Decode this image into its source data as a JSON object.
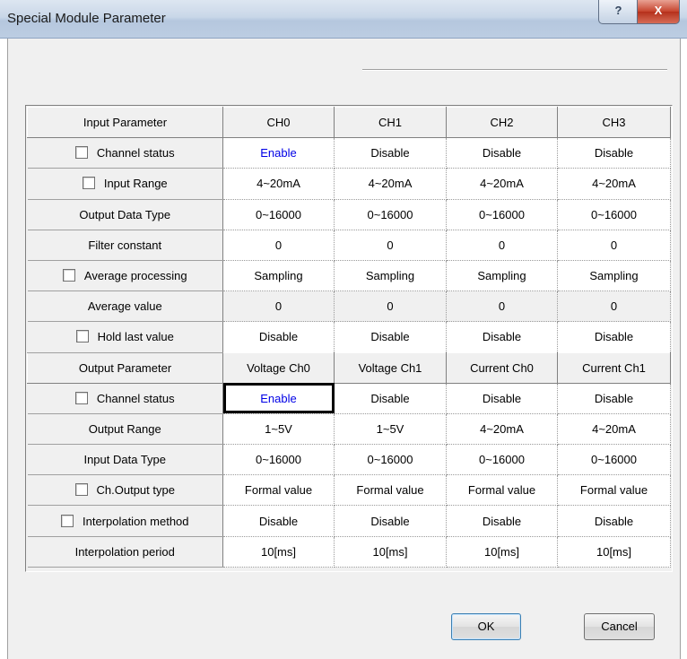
{
  "window": {
    "title": "Special Module Parameter",
    "help_glyph": "?",
    "close_glyph": "X"
  },
  "table": {
    "header": [
      "Input Parameter",
      "CH0",
      "CH1",
      "CH2",
      "CH3"
    ],
    "rows": [
      {
        "label": "Channel status",
        "checkbox": true,
        "values": [
          "Enable",
          "Disable",
          "Disable",
          "Disable"
        ]
      },
      {
        "label": "Input Range",
        "checkbox": true,
        "values": [
          "4~20mA",
          "4~20mA",
          "4~20mA",
          "4~20mA"
        ]
      },
      {
        "label": "Output Data Type",
        "checkbox": false,
        "values": [
          "0~16000",
          "0~16000",
          "0~16000",
          "0~16000"
        ]
      },
      {
        "label": "Filter constant",
        "checkbox": false,
        "values": [
          "0",
          "0",
          "0",
          "0"
        ]
      },
      {
        "label": "Average processing",
        "checkbox": true,
        "values": [
          "Sampling",
          "Sampling",
          "Sampling",
          "Sampling"
        ]
      },
      {
        "label": "Average value",
        "checkbox": false,
        "values": [
          "0",
          "0",
          "0",
          "0"
        ]
      },
      {
        "label": "Hold last value",
        "checkbox": true,
        "values": [
          "Disable",
          "Disable",
          "Disable",
          "Disable"
        ]
      }
    ],
    "output_header": [
      "Output Parameter",
      "Voltage Ch0",
      "Voltage Ch1",
      "Current Ch0",
      "Current Ch1"
    ],
    "output_rows": [
      {
        "label": "Channel status",
        "checkbox": true,
        "values": [
          "Enable",
          "Disable",
          "Disable",
          "Disable"
        ]
      },
      {
        "label": "Output Range",
        "checkbox": false,
        "values": [
          "1~5V",
          "1~5V",
          "4~20mA",
          "4~20mA"
        ]
      },
      {
        "label": "Input Data Type",
        "checkbox": false,
        "values": [
          "0~16000",
          "0~16000",
          "0~16000",
          "0~16000"
        ]
      },
      {
        "label": "Ch.Output type",
        "checkbox": true,
        "values": [
          "Formal value",
          "Formal value",
          "Formal value",
          "Formal value"
        ]
      },
      {
        "label": "Interpolation method",
        "checkbox": true,
        "values": [
          "Disable",
          "Disable",
          "Disable",
          "Disable"
        ]
      },
      {
        "label": "Interpolation period",
        "checkbox": false,
        "values": [
          "10[ms]",
          "10[ms]",
          "10[ms]",
          "10[ms]"
        ]
      }
    ]
  },
  "buttons": {
    "ok": "OK",
    "cancel": "Cancel"
  },
  "colors": {
    "enabled_text": "#0000e6",
    "title_bar": "#c9d7e8"
  }
}
